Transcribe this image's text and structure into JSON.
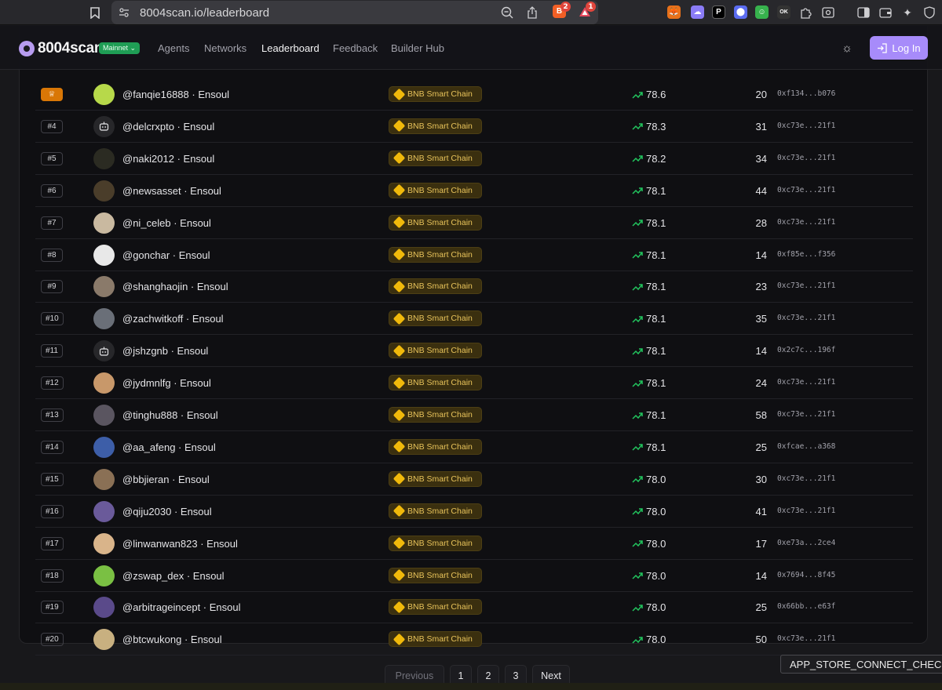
{
  "browser": {
    "url": "8004scan.io/leaderboard",
    "ext_badge_1": "2",
    "ext_badge_2": "1"
  },
  "nav": {
    "logo": "8004scan",
    "network_badge": "Mainnet",
    "links": [
      "Agents",
      "Networks",
      "Leaderboard",
      "Feedback",
      "Builder Hub"
    ],
    "login_label": "Log In"
  },
  "colors": {
    "accent": "#a78bfa",
    "chain_badge": "#e8c35a",
    "trend": "#22c55e",
    "rank_top": "#d97706"
  },
  "rows": [
    {
      "rank": "",
      "name": "@fanqie16888 · Ensoul",
      "chain": "BNB Smart Chain",
      "score": "78.6",
      "count": "20",
      "addr": "0xf134...b076",
      "avatar": "image"
    },
    {
      "rank": "#4",
      "name": "@delcrxpto · Ensoul",
      "chain": "BNB Smart Chain",
      "score": "78.3",
      "count": "31",
      "addr": "0xc73e...21f1",
      "avatar": "bot-icon"
    },
    {
      "rank": "#5",
      "name": "@naki2012 · Ensoul",
      "chain": "BNB Smart Chain",
      "score": "78.2",
      "count": "34",
      "addr": "0xc73e...21f1",
      "avatar": "image"
    },
    {
      "rank": "#6",
      "name": "@newsasset · Ensoul",
      "chain": "BNB Smart Chain",
      "score": "78.1",
      "count": "44",
      "addr": "0xc73e...21f1",
      "avatar": "image"
    },
    {
      "rank": "#7",
      "name": "@ni_celeb · Ensoul",
      "chain": "BNB Smart Chain",
      "score": "78.1",
      "count": "28",
      "addr": "0xc73e...21f1",
      "avatar": "image"
    },
    {
      "rank": "#8",
      "name": "@gonchar · Ensoul",
      "chain": "BNB Smart Chain",
      "score": "78.1",
      "count": "14",
      "addr": "0xf85e...f356",
      "avatar": "image"
    },
    {
      "rank": "#9",
      "name": "@shanghaojin · Ensoul",
      "chain": "BNB Smart Chain",
      "score": "78.1",
      "count": "23",
      "addr": "0xc73e...21f1",
      "avatar": "image"
    },
    {
      "rank": "#10",
      "name": "@zachwitkoff · Ensoul",
      "chain": "BNB Smart Chain",
      "score": "78.1",
      "count": "35",
      "addr": "0xc73e...21f1",
      "avatar": "image"
    },
    {
      "rank": "#11",
      "name": "@jshzgnb · Ensoul",
      "chain": "BNB Smart Chain",
      "score": "78.1",
      "count": "14",
      "addr": "0x2c7c...196f",
      "avatar": "bot-icon"
    },
    {
      "rank": "#12",
      "name": "@jydmnlfg · Ensoul",
      "chain": "BNB Smart Chain",
      "score": "78.1",
      "count": "24",
      "addr": "0xc73e...21f1",
      "avatar": "image"
    },
    {
      "rank": "#13",
      "name": "@tinghu888 · Ensoul",
      "chain": "BNB Smart Chain",
      "score": "78.1",
      "count": "58",
      "addr": "0xc73e...21f1",
      "avatar": "image"
    },
    {
      "rank": "#14",
      "name": "@aa_afeng · Ensoul",
      "chain": "BNB Smart Chain",
      "score": "78.1",
      "count": "25",
      "addr": "0xfcae...a368",
      "avatar": "image"
    },
    {
      "rank": "#15",
      "name": "@bbjieran · Ensoul",
      "chain": "BNB Smart Chain",
      "score": "78.0",
      "count": "30",
      "addr": "0xc73e...21f1",
      "avatar": "image"
    },
    {
      "rank": "#16",
      "name": "@qiju2030 · Ensoul",
      "chain": "BNB Smart Chain",
      "score": "78.0",
      "count": "41",
      "addr": "0xc73e...21f1",
      "avatar": "image"
    },
    {
      "rank": "#17",
      "name": "@linwanwan823 · Ensoul",
      "chain": "BNB Smart Chain",
      "score": "78.0",
      "count": "17",
      "addr": "0xe73a...2ce4",
      "avatar": "image"
    },
    {
      "rank": "#18",
      "name": "@zswap_dex · Ensoul",
      "chain": "BNB Smart Chain",
      "score": "78.0",
      "count": "14",
      "addr": "0x7694...8f45",
      "avatar": "image"
    },
    {
      "rank": "#19",
      "name": "@arbitrageincept · Ensoul",
      "chain": "BNB Smart Chain",
      "score": "78.0",
      "count": "25",
      "addr": "0x66bb...e63f",
      "avatar": "image"
    },
    {
      "rank": "#20",
      "name": "@btcwukong · Ensoul",
      "chain": "BNB Smart Chain",
      "score": "78.0",
      "count": "50",
      "addr": "0xc73e...21f1",
      "avatar": "image"
    }
  ],
  "pagination": {
    "previous": "Previous",
    "pages": [
      "1",
      "2",
      "3"
    ],
    "next": "Next"
  },
  "tooltip": "APP_STORE_CONNECT_CHECK"
}
